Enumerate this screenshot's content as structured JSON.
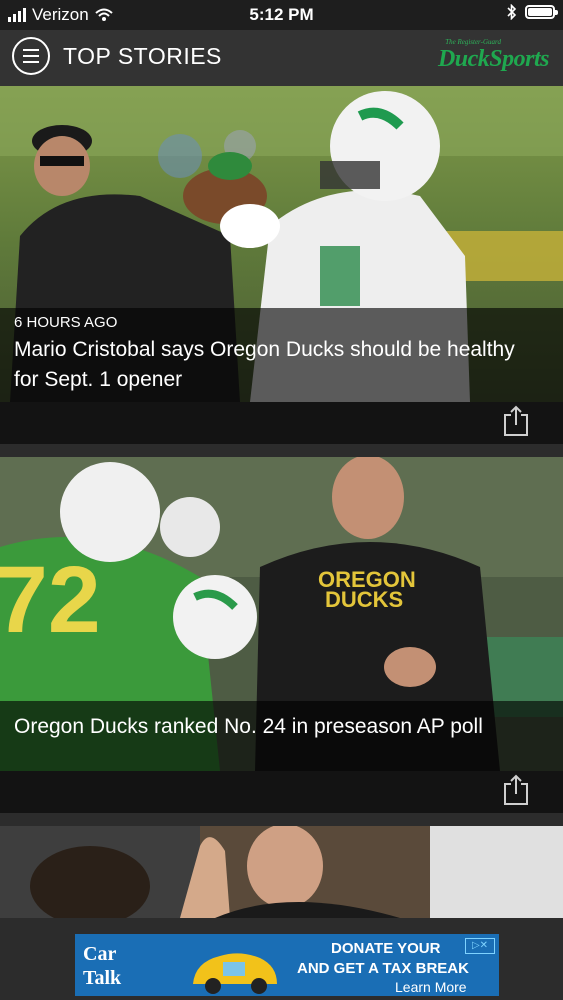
{
  "status_bar": {
    "carrier": "Verizon",
    "time": "5:12 PM"
  },
  "header": {
    "title": "TOP STORIES",
    "logo_small": "The Register-Guard",
    "logo_text": "DuckSports"
  },
  "stories": [
    {
      "time_ago": "6 HOURS AGO",
      "headline": "Mario Cristobal says Oregon Ducks should be healthy for Sept. 1 opener"
    },
    {
      "time_ago": "",
      "headline": "Oregon Ducks ranked No. 24 in preseason AP poll"
    }
  ],
  "ad": {
    "brand": "Car Talk",
    "line1": "DONATE YOUR",
    "line2": "AND GET A TAX BREAK",
    "line3": "Learn More",
    "choice_label": "ad-choices"
  },
  "colors": {
    "accent": "#1fa84f",
    "header_bg": "#333333",
    "ad_bg": "#1a6eb5"
  }
}
